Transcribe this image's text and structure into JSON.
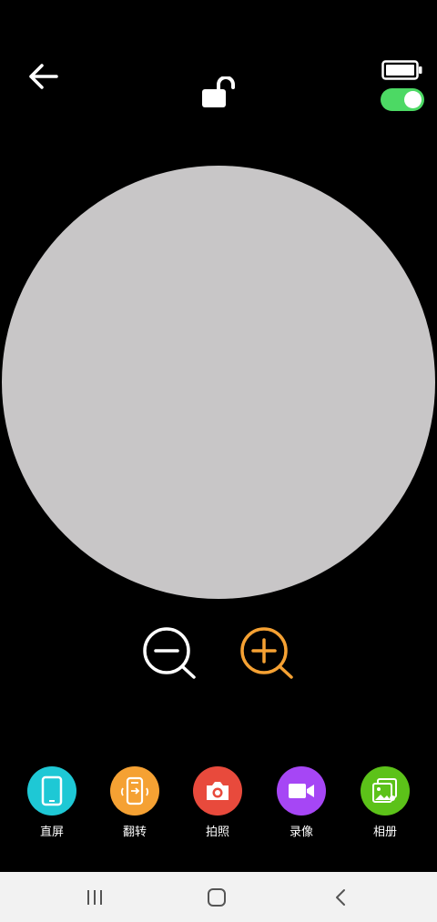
{
  "icons": {
    "back": "arrow-left-icon",
    "lock": "unlock-icon",
    "battery": "battery-icon",
    "zoom_out": "zoom-out-icon",
    "zoom_in": "zoom-in-icon"
  },
  "colors": {
    "toggle_on": "#4cd964",
    "preview": "#c8c6c7",
    "zoom_out": "#ffffff",
    "zoom_in": "#f5a133"
  },
  "toggle": {
    "state": "on"
  },
  "toolbar": [
    {
      "label": "直屏",
      "icon": "phone-portrait-icon",
      "color": "#1ec8d5"
    },
    {
      "label": "翻转",
      "icon": "phone-rotate-icon",
      "color": "#f5a133"
    },
    {
      "label": "拍照",
      "icon": "camera-icon",
      "color": "#e84a3c"
    },
    {
      "label": "录像",
      "icon": "video-camera-icon",
      "color": "#a646f5"
    },
    {
      "label": "相册",
      "icon": "gallery-icon",
      "color": "#5cc219"
    }
  ],
  "navbar": {
    "recent": "recent-apps-icon",
    "home": "home-icon",
    "back": "back-chevron-icon"
  }
}
